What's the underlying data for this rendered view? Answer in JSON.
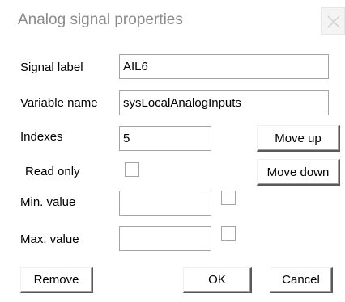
{
  "window": {
    "title": "Analog signal properties",
    "close_icon": "close-icon"
  },
  "form": {
    "signal_label": {
      "label": "Signal label",
      "value": "AIL6"
    },
    "variable_name": {
      "label": "Variable name",
      "value": "sysLocalAnalogInputs"
    },
    "indexes": {
      "label": "Indexes",
      "value": "5"
    },
    "read_only": {
      "label": "Read only",
      "checked": false
    },
    "min_value": {
      "label": "Min. value",
      "value": "",
      "checked": false
    },
    "max_value": {
      "label": "Max. value",
      "value": "",
      "checked": false
    }
  },
  "buttons": {
    "move_up": "Move up",
    "move_down": "Move down",
    "remove": "Remove",
    "ok": "OK",
    "cancel": "Cancel"
  },
  "colors": {
    "title_text": "#8a8a8a",
    "field_border": "#a5a5a5",
    "button_shadow": "#595959"
  }
}
